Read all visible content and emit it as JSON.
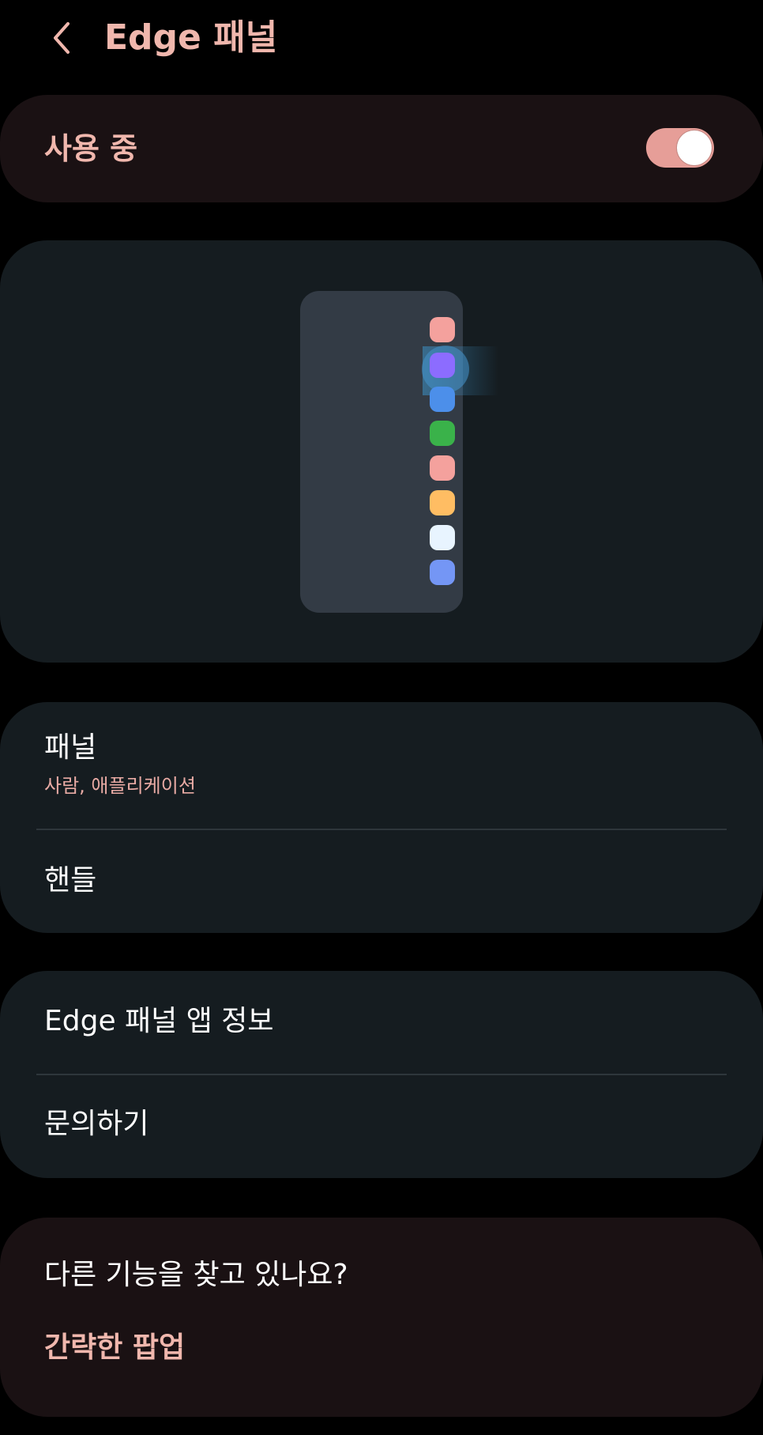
{
  "header": {
    "title": "Edge 패널"
  },
  "master": {
    "label": "사용 중",
    "enabled": true,
    "toggle_on_color": "#e69e98"
  },
  "preview": {
    "app_icon_colors": [
      "#f4a19d",
      "#8c6cff",
      "#4c8fea",
      "#3ab24a",
      "#f4a19d",
      "#ffbd63",
      "#e8f4ff",
      "#7496f5"
    ]
  },
  "panels": {
    "title": "패널",
    "subtitle": "사람, 애플리케이션"
  },
  "handle": {
    "title": "핸들"
  },
  "about": {
    "title": "Edge 패널 앱 정보"
  },
  "contact": {
    "title": "문의하기"
  },
  "suggestion": {
    "title": "다른 기능을 찾고 있나요?",
    "link": "간략한 팝업"
  },
  "colors": {
    "accent": "#f0b7ad",
    "card": "#151c20",
    "card_warm": "#1a1113",
    "background": "#000000"
  }
}
